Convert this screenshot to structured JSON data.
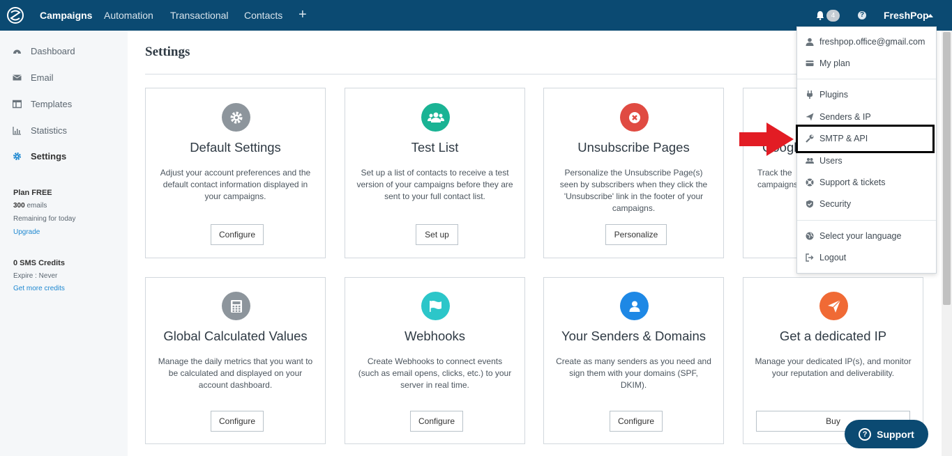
{
  "topbar": {
    "nav": [
      "Campaigns",
      "Automation",
      "Transactional",
      "Contacts"
    ],
    "plus": "+",
    "notifications": "4",
    "help": "?",
    "user": "FreshPop"
  },
  "sidebar": {
    "items": [
      {
        "label": "Dashboard",
        "icon": "dashboard-icon"
      },
      {
        "label": "Email",
        "icon": "email-icon"
      },
      {
        "label": "Templates",
        "icon": "templates-icon"
      },
      {
        "label": "Statistics",
        "icon": "statistics-icon"
      },
      {
        "label": "Settings",
        "icon": "gear-icon"
      }
    ],
    "plan": {
      "name": "Plan FREE",
      "emails_count": "300",
      "emails_unit": "emails",
      "remaining": "Remaining for today",
      "upgrade": "Upgrade",
      "sms": "0 SMS Credits",
      "expire": "Expire : Never",
      "more": "Get more credits"
    }
  },
  "main": {
    "title": "Settings",
    "cards": [
      {
        "title": "Default Settings",
        "desc": "Adjust your account preferences and the default contact information displayed in your campaigns.",
        "button": "Configure",
        "color": "#8d959c",
        "icon": "gear-icon"
      },
      {
        "title": "Test List",
        "desc": "Set up a list of contacts to receive a test version of your campaigns before they are sent to your full contact list.",
        "button": "Set up",
        "color": "#1ab394",
        "icon": "users-icon"
      },
      {
        "title": "Unsubscribe Pages",
        "desc": "Personalize the Unsubscribe Page(s) seen by subscribers when they click the 'Unsubscribe' link in the footer of your campaigns.",
        "button": "Personalize",
        "color": "#e04b42",
        "icon": "close-icon"
      },
      {
        "title": "Google",
        "desc": "Track the campaigns",
        "button": "",
        "color": "#f5a623",
        "icon": "google-icon"
      },
      {
        "title": "Global Calculated Values",
        "desc": "Manage the daily metrics that you want to be calculated and displayed on your account dashboard.",
        "button": "Configure",
        "color": "#8d959c",
        "icon": "calculator-icon"
      },
      {
        "title": "Webhooks",
        "desc": "Create Webhooks to connect events (such as email opens, clicks, etc.) to your server in real time.",
        "button": "Configure",
        "color": "#2cc6c9",
        "icon": "flag-icon"
      },
      {
        "title": "Your Senders & Domains",
        "desc": "Create as many senders as you need and sign them with your domains (SPF, DKIM).",
        "button": "Configure",
        "color": "#1e88e5",
        "icon": "user-icon"
      },
      {
        "title": "Get a dedicated IP",
        "desc": "Manage your dedicated IP(s), and monitor your reputation and deliverability.",
        "button": "Buy",
        "color": "#f06a35",
        "icon": "send-icon"
      }
    ]
  },
  "dropdown": {
    "items": [
      {
        "label": "freshpop.office@gmail.com",
        "icon": "user-icon"
      },
      {
        "label": "My plan",
        "icon": "card-icon"
      },
      {
        "label": "Plugins",
        "icon": "plug-icon"
      },
      {
        "label": "Senders & IP",
        "icon": "send-icon"
      },
      {
        "label": "SMTP & API",
        "icon": "wrench-icon"
      },
      {
        "label": "Users",
        "icon": "users-icon"
      },
      {
        "label": "Support & tickets",
        "icon": "lifebuoy-icon"
      },
      {
        "label": "Security",
        "icon": "shield-icon"
      },
      {
        "label": "Select your language",
        "icon": "globe-icon"
      },
      {
        "label": "Logout",
        "icon": "logout-icon"
      }
    ]
  },
  "support": {
    "label": "Support",
    "icon": "?"
  },
  "colors": {
    "nav": "#0b4a72",
    "link": "#1e88d1",
    "highlight_arrow": "#e21c24"
  }
}
